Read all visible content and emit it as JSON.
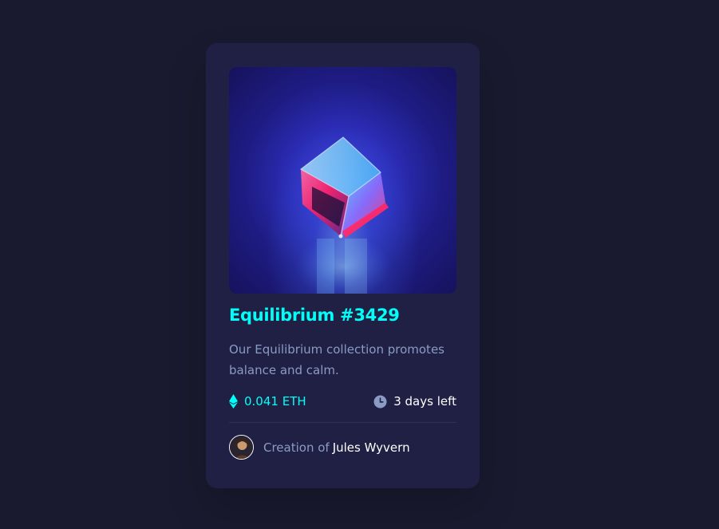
{
  "card": {
    "title": "Equilibrium #3429",
    "description": "Our Equilibrium collection promotes balance and calm.",
    "price": "0.041 ETH",
    "time_left": "3 days left",
    "creator_prefix": "Creation of",
    "creator_name": "Jules Wyvern"
  },
  "icons": {
    "price": "ethereum-icon",
    "time": "clock-icon",
    "avatar": "avatar"
  },
  "colors": {
    "page_background": "#191a2f",
    "card_background": "#1f2043",
    "accent": "#00fff8",
    "muted_text": "#8b9bc5",
    "divider": "#2e3056",
    "white": "#ffffff"
  }
}
